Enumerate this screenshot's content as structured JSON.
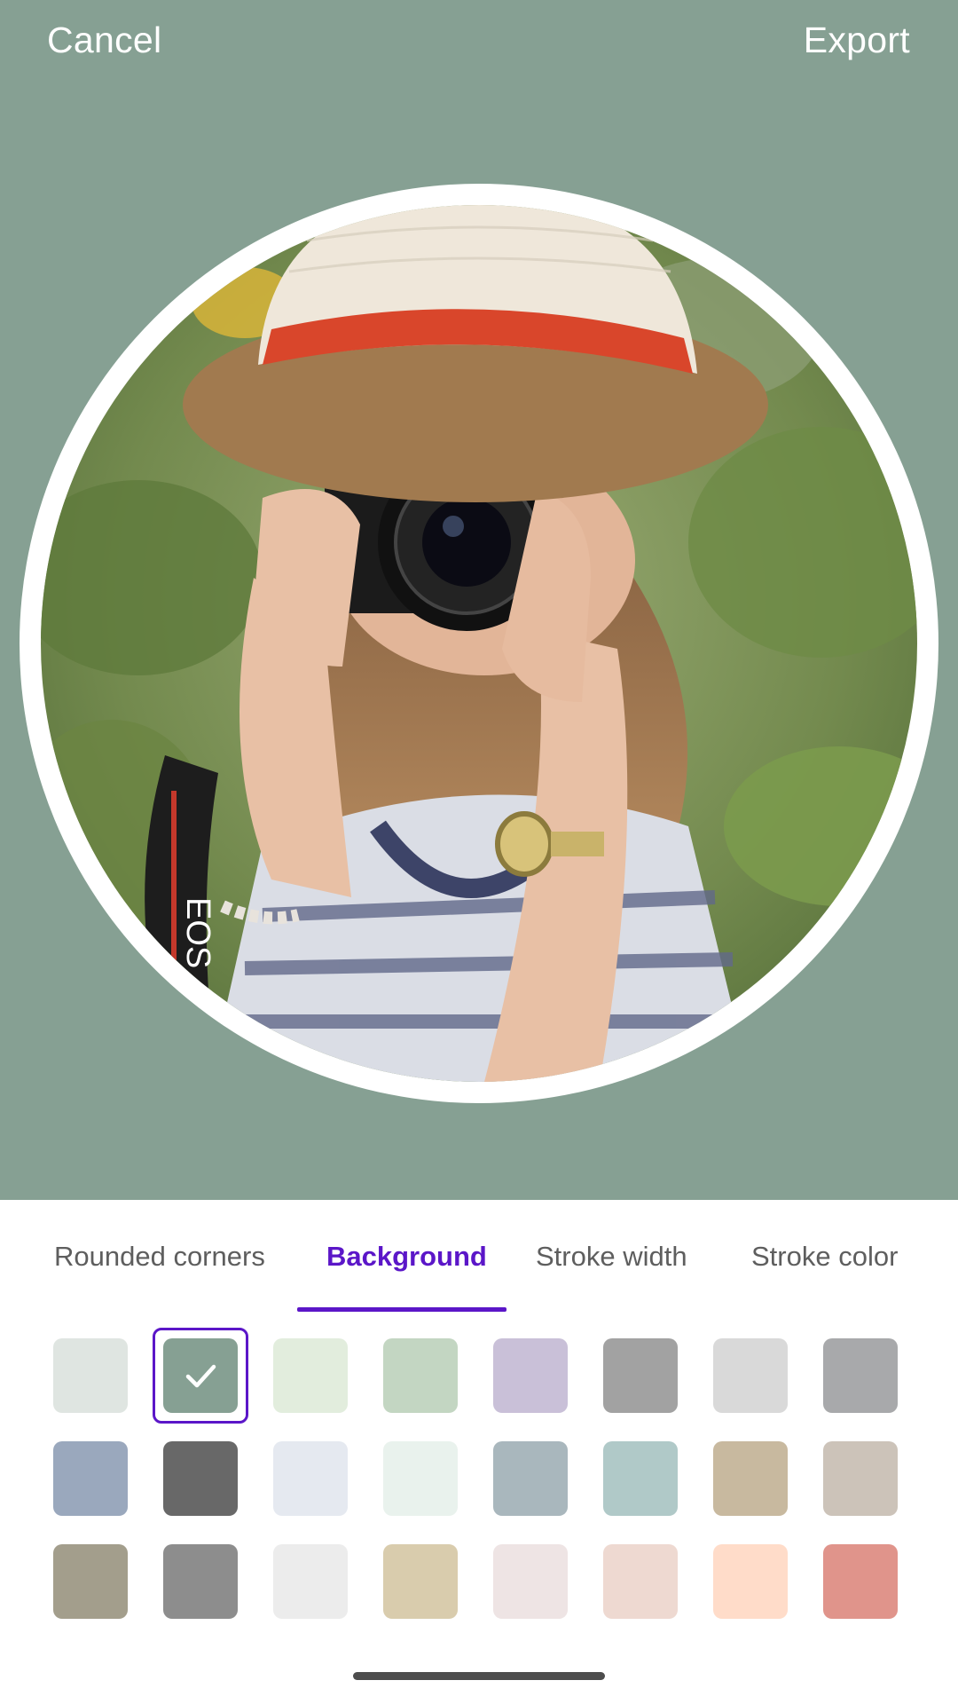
{
  "header": {
    "cancel_label": "Cancel",
    "export_label": "Export"
  },
  "preview": {
    "background_color": "#86a093",
    "border_color": "#ffffff"
  },
  "tabs": [
    {
      "label": "Rounded corners",
      "active": false
    },
    {
      "label": "Background",
      "active": true
    },
    {
      "label": "Stroke width",
      "active": false
    },
    {
      "label": "Stroke color",
      "active": false
    }
  ],
  "swatches": [
    "#dfe5e1",
    "#86a093",
    "#e2eddd",
    "#c3d6c2",
    "#c9c0d8",
    "#a2a2a2",
    "#d9d9d9",
    "#a8a9ab",
    "#9aa8bd",
    "#686868",
    "#e5e9f0",
    "#e9f2ed",
    "#a9b7bd",
    "#b0c9c8",
    "#c8b99f",
    "#ccc3b9",
    "#a39e8c",
    "#8d8d8d",
    "#ececec",
    "#d9ccad",
    "#eee4e4",
    "#eed9d1",
    "#ffdcc9",
    "#e0948b"
  ],
  "selected_swatch_index": 1,
  "accent_color": "#5b16c8"
}
